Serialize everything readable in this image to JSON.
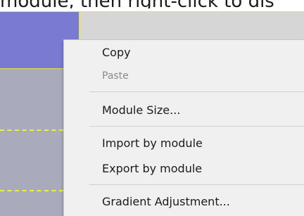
{
  "top_text": "module, then right-click to dis",
  "menu": {
    "copy": "Copy",
    "paste": "Paste",
    "module_size": "Module Size...",
    "import_by_module": "Import by module",
    "export_by_module": "Export by module",
    "gradient_adjustment": "Gradient Adjustment..."
  },
  "colors": {
    "selected_module": "#7a7ad2",
    "module_border": "#e6e24a",
    "menu_background": "#f0f0f0"
  }
}
